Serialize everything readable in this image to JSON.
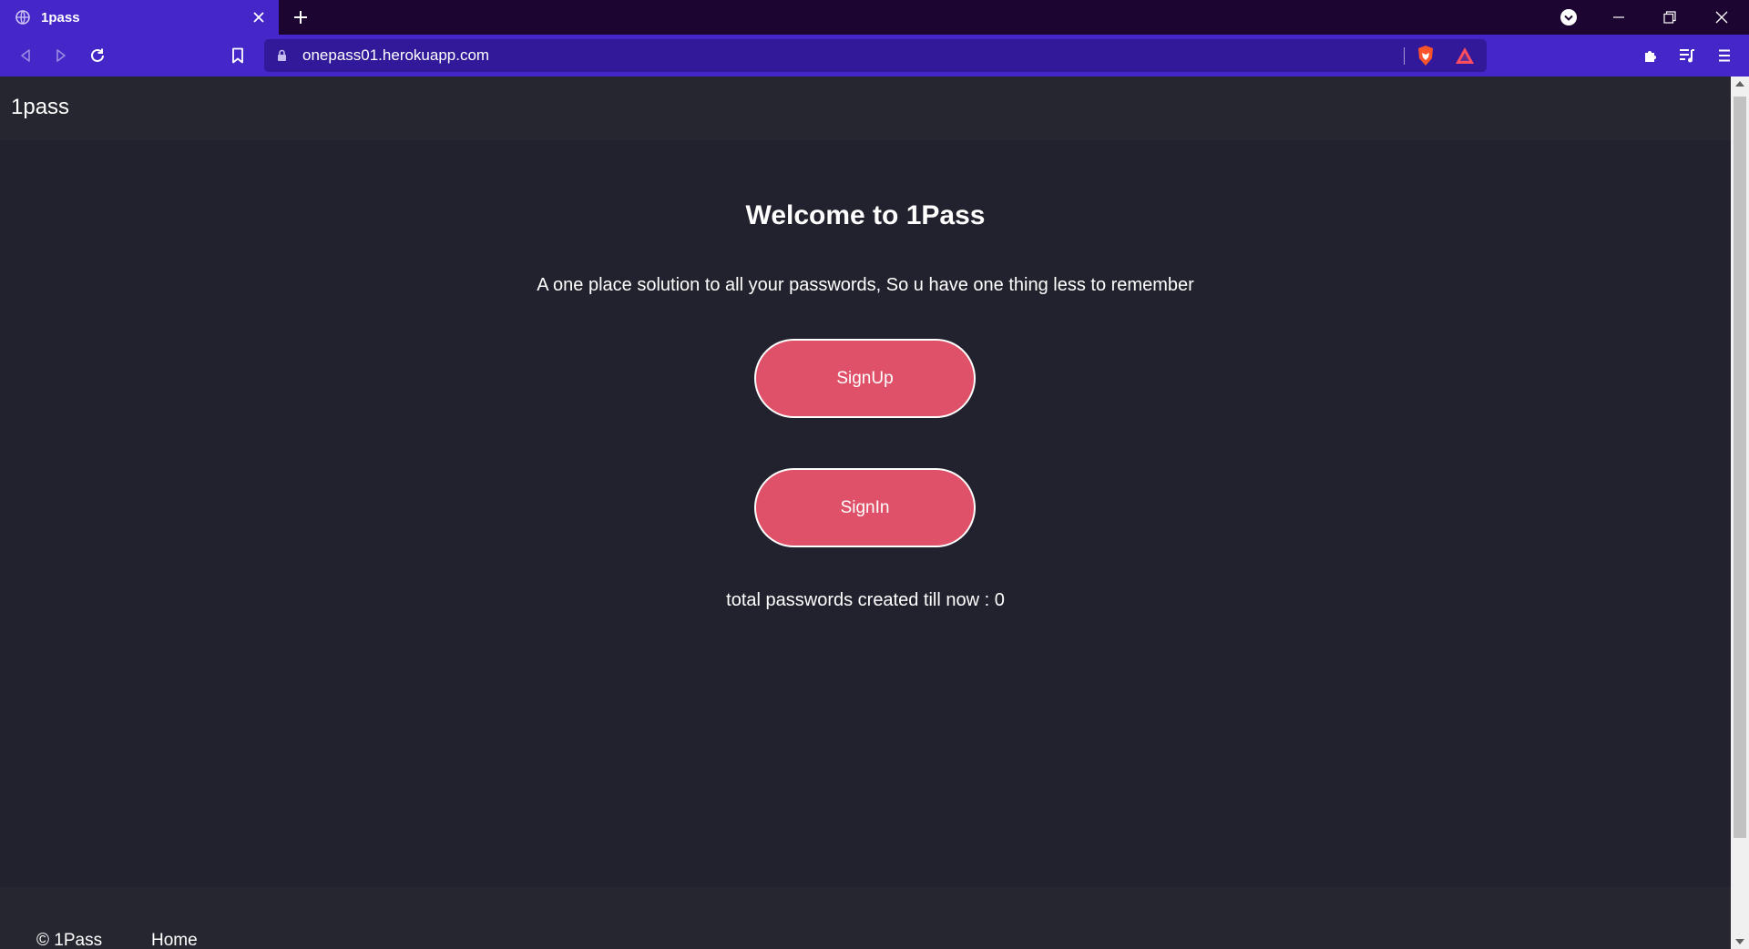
{
  "browser": {
    "tab_title": "1pass",
    "url": "onepass01.herokuapp.com"
  },
  "page": {
    "brand": "1pass",
    "heading": "Welcome to 1Pass",
    "tagline": "A one place solution to all your passwords, So u have one thing less to remember",
    "signup_label": "SignUp",
    "signin_label": "SignIn",
    "count_text": "total passwords created till now : 0"
  },
  "footer": {
    "copyright": "© 1Pass",
    "home_link": "Home"
  },
  "colors": {
    "chrome_accent": "#4527c9",
    "tabstrip_bg": "#1c0530",
    "page_bg": "#22222e",
    "button_bg": "#df5168"
  }
}
